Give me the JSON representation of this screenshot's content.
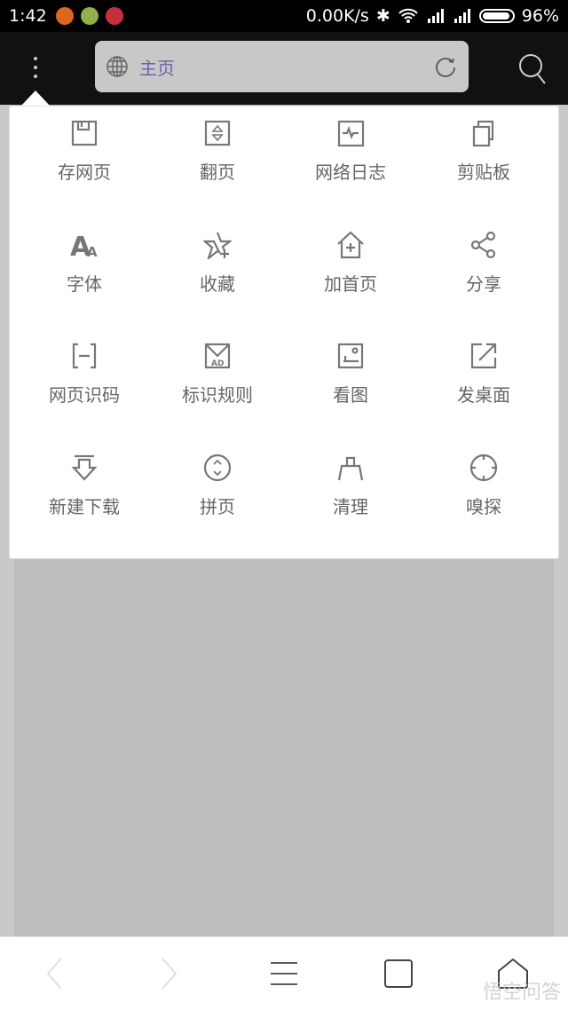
{
  "status_bar": {
    "time": "1:42",
    "app_icon_colors": [
      "#e0661f",
      "#8fb04a",
      "#c6303c"
    ],
    "network_speed": "0.00K/s",
    "battery": "96%",
    "battery_level": 0.96
  },
  "toolbar": {
    "menu_icon": "more-vertical-icon",
    "address": {
      "icon": "globe-icon",
      "title": "主页",
      "reload_icon": "reload-icon"
    },
    "search_icon": "search-icon"
  },
  "menu": {
    "items": [
      {
        "label": "存网页",
        "icon": "save-icon"
      },
      {
        "label": "翻页",
        "icon": "page-flip-icon"
      },
      {
        "label": "网络日志",
        "icon": "network-log-icon"
      },
      {
        "label": "剪贴板",
        "icon": "clipboard-icon"
      },
      {
        "label": "字体",
        "icon": "font-icon"
      },
      {
        "label": "收藏",
        "icon": "star-add-icon"
      },
      {
        "label": "加首页",
        "icon": "home-add-icon"
      },
      {
        "label": "分享",
        "icon": "share-icon"
      },
      {
        "label": "网页识码",
        "icon": "scan-code-icon"
      },
      {
        "label": "标识规则",
        "icon": "ad-rule-icon"
      },
      {
        "label": "看图",
        "icon": "image-view-icon"
      },
      {
        "label": "发桌面",
        "icon": "send-desktop-icon"
      },
      {
        "label": "新建下载",
        "icon": "download-icon"
      },
      {
        "label": "拼页",
        "icon": "page-merge-icon"
      },
      {
        "label": "清理",
        "icon": "clean-icon"
      },
      {
        "label": "嗅探",
        "icon": "sniff-icon"
      }
    ]
  },
  "bottom_nav": [
    "back-icon",
    "forward-icon",
    "menu-icon",
    "tabs-icon",
    "home-icon"
  ],
  "watermark": "悟空问答",
  "colors": {
    "accent": "#6d62a8",
    "icon": "#777777"
  }
}
